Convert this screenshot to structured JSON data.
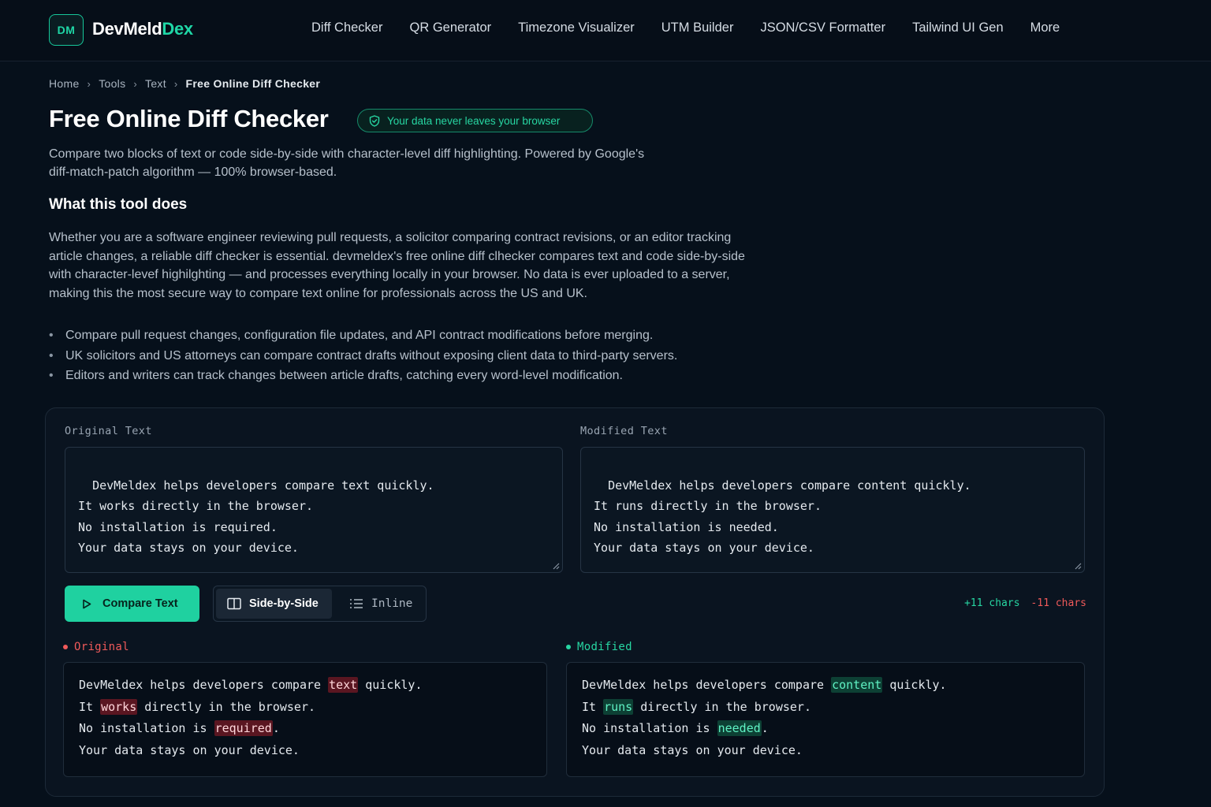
{
  "header": {
    "logo_badge": "DM",
    "logo_main": "DevMeld",
    "logo_accent": "Dex",
    "nav": [
      "Diff Checker",
      "QR Generator",
      "Timezone Visualizer",
      "UTM Builder",
      "JSON/CSV Formatter",
      "Tailwind UI Gen",
      "More"
    ]
  },
  "breadcrumb": {
    "items": [
      "Home",
      "Tools",
      "Text"
    ],
    "current": "Free Online Diff Checker",
    "separator": "›"
  },
  "page": {
    "title": "Free Online Diff Checker",
    "privacy_badge": "Your data never leaves your browser",
    "subtitle": "Compare two blocks of text or code side-by-side with character-level diff highlighting. Powered by Google's diff-match-patch algorithm — 100% browser-based.",
    "section_heading": "What this tool does",
    "section_body": "Whether you are a software engineer reviewing pull requests, a solicitor comparing contract revisions, or an editor tracking article changes, a reliable diff checker is essential. devmeldex's free online diff clhecker compares text and code side-by-side with character-levef highilghting — and processes everything locally in your browser. No data is ever uploaded to a server, making this the most secure way to compare text online for professionals across the US and UK.",
    "bullets": [
      "Compare pull request changes, configuration file updates, and API contract modifications before merging.",
      "UK solicitors and US attorneys can compare contract drafts without exposing client data to third-party servers.",
      "Editors and writers can track changes between article drafts, catching every word-level modification."
    ]
  },
  "tool": {
    "original_label": "Original Text",
    "modified_label": "Modified Text",
    "original_text": "DevMeldex helps developers compare text quickly.\nIt works directly in the browser.\nNo installation is required.\nYour data stays on your device.",
    "modified_text": "DevMeldex helps developers compare content quickly.\nIt runs directly in the browser.\nNo installation is needed.\nYour data stays on your device.",
    "compare_button": "Compare Text",
    "view_side": "Side-by-Side",
    "view_inline": "Inline",
    "stats_added": "+11 chars",
    "stats_removed": "-11 chars",
    "result_original_label": "Original",
    "result_modified_label": "Modified",
    "result_original": [
      [
        {
          "t": "DevMeldex helps developers compare "
        },
        {
          "t": "text",
          "k": "del"
        },
        {
          "t": " quickly."
        }
      ],
      [
        {
          "t": "It "
        },
        {
          "t": "works",
          "k": "del"
        },
        {
          "t": " directly in the browser."
        }
      ],
      [
        {
          "t": "No installation is "
        },
        {
          "t": "required",
          "k": "del"
        },
        {
          "t": "."
        }
      ],
      [
        {
          "t": "Your data stays on your device."
        }
      ]
    ],
    "result_modified": [
      [
        {
          "t": "DevMeldex helps developers compare "
        },
        {
          "t": "content",
          "k": "ins"
        },
        {
          "t": " quickly."
        }
      ],
      [
        {
          "t": "It "
        },
        {
          "t": "runs",
          "k": "ins"
        },
        {
          "t": " directly in the browser."
        }
      ],
      [
        {
          "t": "No installation is "
        },
        {
          "t": "needed",
          "k": "ins"
        },
        {
          "t": "."
        }
      ],
      [
        {
          "t": "Your data stays on your device."
        }
      ]
    ]
  },
  "colors": {
    "accent": "#1fd1a0",
    "deleted": "#f05a5a",
    "added": "#27d6a2",
    "background": "#06101b"
  },
  "icons": {
    "shield": "shield-check-icon",
    "play": "play-icon",
    "columns": "columns-icon",
    "list": "list-icon"
  }
}
